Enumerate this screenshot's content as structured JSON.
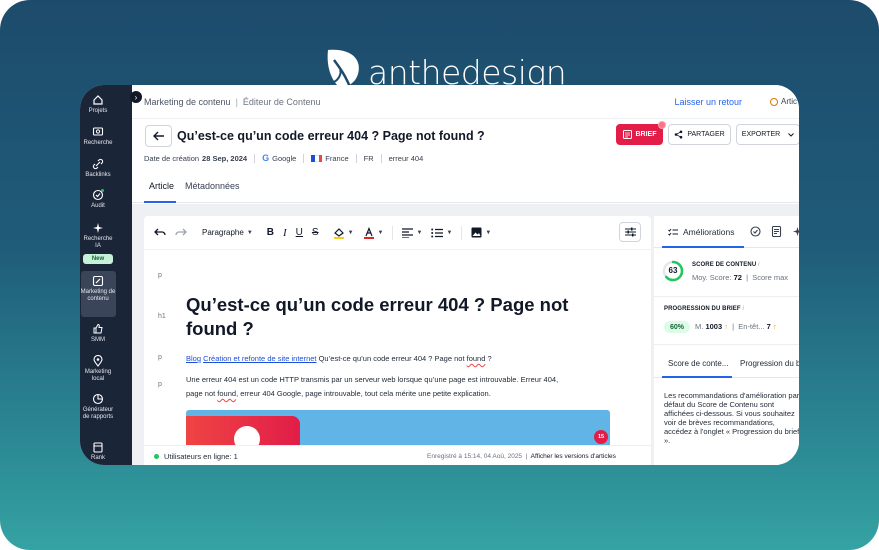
{
  "brand": {
    "logo_text": "anthedesign"
  },
  "sidebar": {
    "items": [
      {
        "label": "Projets",
        "icon": "home-icon"
      },
      {
        "label": "Recherche",
        "icon": "search-icon"
      },
      {
        "label": "Backlinks",
        "icon": "link-icon"
      },
      {
        "label": "Audit",
        "icon": "check-circle-icon"
      },
      {
        "label": "Recherche IA",
        "icon": "sparkle-icon"
      },
      {
        "label": "Marketing de contenu",
        "icon": "edit-icon"
      },
      {
        "label": "SMM",
        "icon": "thumbs-up-icon"
      },
      {
        "label": "Marketing local",
        "icon": "map-pin-icon"
      },
      {
        "label": "Générateur de rapports",
        "icon": "pie-chart-icon"
      },
      {
        "label": "Rank",
        "icon": "calendar-icon"
      }
    ],
    "new_badge": "New"
  },
  "breadcrumb": {
    "parent": "Marketing de contenu",
    "current": "Éditeur de Contenu"
  },
  "header": {
    "feedback_link": "Laisser un retour",
    "right_item": "Artic",
    "title": "Qu’est-ce qu’un code erreur 404 ? Page not found ?"
  },
  "meta": {
    "created_label": "Date de création",
    "created_date": "28 Sep, 2024",
    "search_engine": "Google",
    "country": "France",
    "language": "FR",
    "keyword": "erreur 404"
  },
  "actions": {
    "brief": "BRIEF",
    "share": "PARTAGER",
    "export": "EXPORTER"
  },
  "tabs": {
    "article": "Article",
    "metadata": "Métadonnées"
  },
  "toolbar": {
    "paragraph_select": "Paragraphe"
  },
  "editor": {
    "tag_p": "p",
    "tag_h1": "h1",
    "heading": "Qu’est-ce qu’un code erreur 404 ? Page not found ?",
    "crumb_link_1": "Blog",
    "crumb_link_2": "Création et refonte de site internet",
    "crumb_text_1": " Qu’est-ce qu’un code erreur 404 ? Page not ",
    "crumb_text_found": "found",
    "crumb_text_2": " ?",
    "intro_1": "Une erreur 404 est un code HTTP transmis par un serveur web lorsque qu’une page est introuvable. Erreur 404,",
    "intro_2a": "page not ",
    "intro_2_found": "found",
    "intro_2b": ", erreur 404 Google, page introuvable, tout cela mérite une petite explication.",
    "image_badge": "15"
  },
  "status": {
    "online": "Utilisateurs en ligne: 1",
    "saved": "Enregistré à 15:14, 04 Aoû, 2025",
    "versions_link": "Afficher les versions d'articles"
  },
  "panel": {
    "tab_improvements": "Améliorations",
    "content_score_title": "SCORE DE CONTENU",
    "content_score": "63",
    "content_score_value": 63,
    "avg_label": "Moy. Score:",
    "avg_value": "72",
    "max_label": "Score max",
    "brief_title": "PROGRESSION DU BRIEF",
    "brief_pct": "60%",
    "words_label": "M.",
    "words_value": "1003",
    "headings_label": "En-têt...",
    "headings_value": "7",
    "subtab_1": "Score de conte...",
    "subtab_2": "Progression du b",
    "recommendation_text": "Les recommandations d'amélioration par défaut du Score de Contenu sont affichées ci-dessous. Si vous souhaitez voir de brèves recommandations, accédez à l'onglet « Progression du brief »."
  },
  "colors": {
    "background_top": "#1d4b6c",
    "background_bottom": "#35a3a3",
    "sidebar": "#1b2538",
    "accent_blue": "#2563eb",
    "brief_red": "#e11d48",
    "score_green": "#22c55e"
  }
}
